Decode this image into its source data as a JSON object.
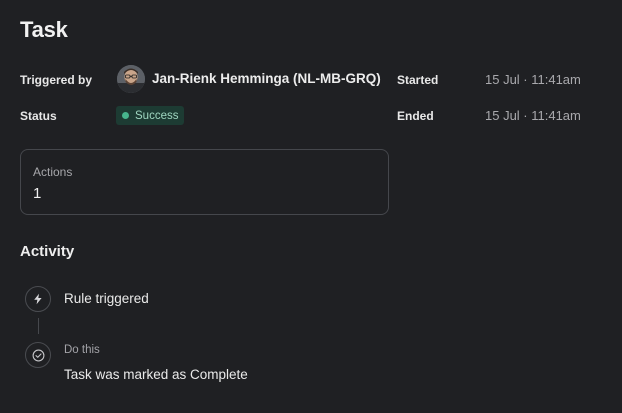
{
  "task": {
    "title": "Task"
  },
  "meta": {
    "triggered_by_label": "Triggered by",
    "user_name": "Jan-Rienk Hemminga (NL-MB-GRQ)",
    "started_label": "Started",
    "started_value": "15 Jul · 11:41am",
    "status_label": "Status",
    "status_value": "Success",
    "ended_label": "Ended",
    "ended_value": "15 Jul · 11:41am"
  },
  "actions_card": {
    "label": "Actions",
    "value": "1"
  },
  "activity": {
    "title": "Activity",
    "items": [
      {
        "icon": "lightning-bolt-icon",
        "text": "Rule triggered"
      },
      {
        "icon": "check-circle-icon",
        "subtitle": "Do this",
        "text": "Task was marked as Complete"
      }
    ]
  },
  "colors": {
    "background": "#1f2023",
    "status_badge_bg": "#1d3b33",
    "status_dot": "#47b58d",
    "card_border": "#45474c"
  }
}
